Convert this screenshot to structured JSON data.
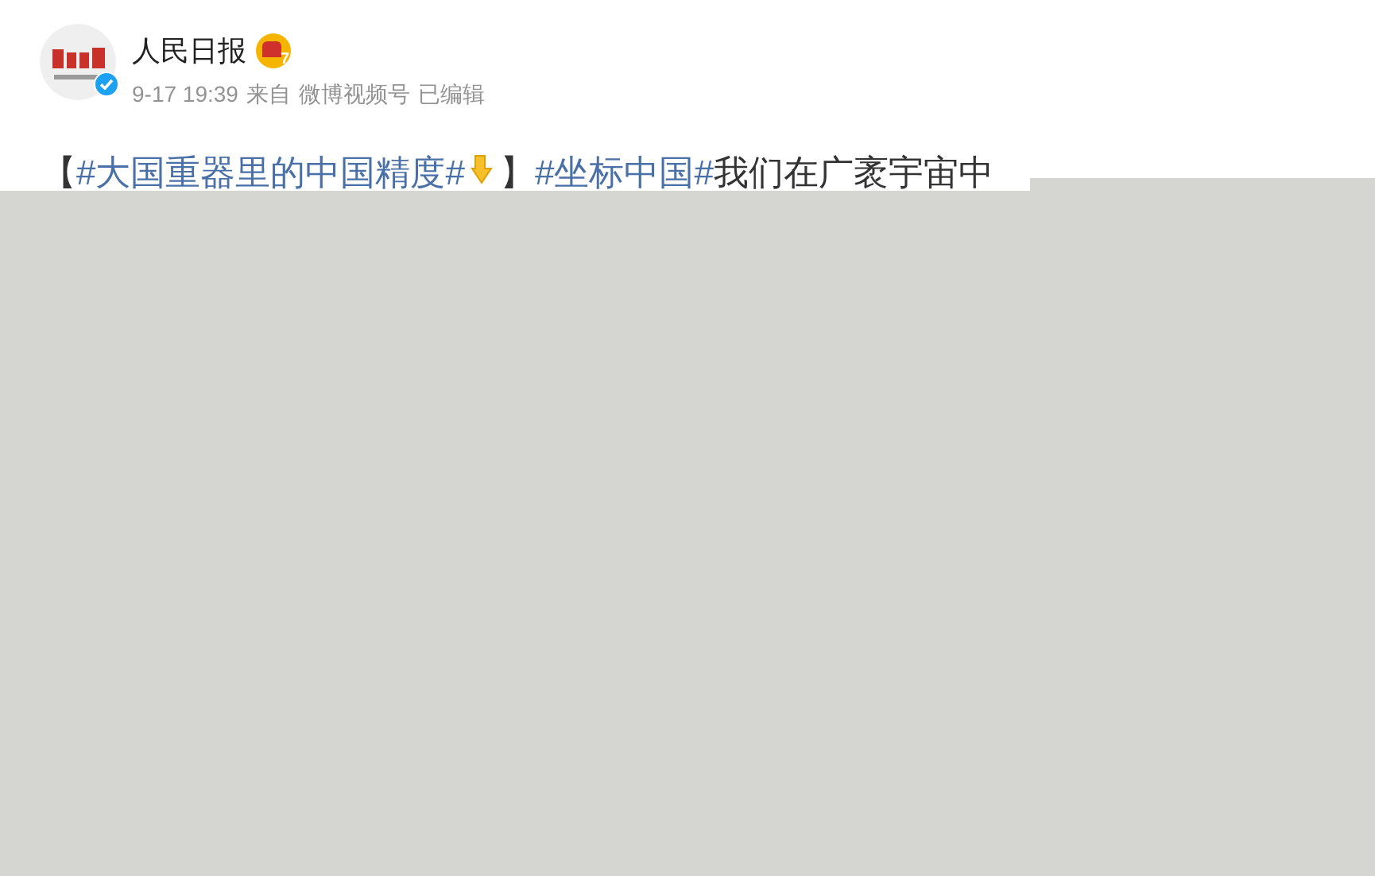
{
  "author": {
    "verified": true,
    "name": "人民日报",
    "member_badge": "7"
  },
  "meta": {
    "time": "9-17 19:39",
    "source_prefix": "来自",
    "source": "微博视频号",
    "edited": "已编辑"
  },
  "post": {
    "segments": [
      {
        "kind": "text",
        "text": "【"
      },
      {
        "kind": "hashtag",
        "text": "#大国重器里的中国精度#"
      },
      {
        "kind": "emoji"
      },
      {
        "kind": "text",
        "text": "】"
      },
      {
        "kind": "hashtag",
        "text": "#坐标中国#"
      },
      {
        "kind": "text",
        "text": "我们在广袤宇宙中"
      }
    ]
  }
}
